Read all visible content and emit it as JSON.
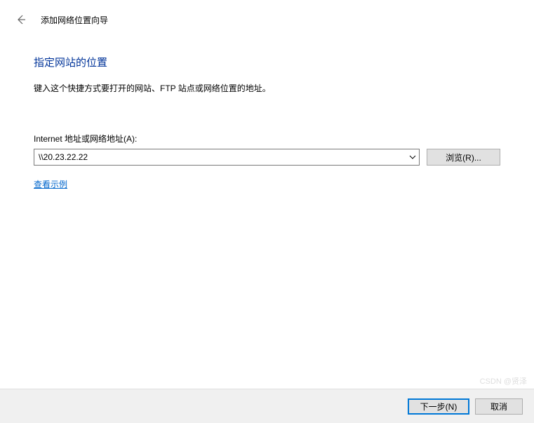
{
  "header": {
    "title": "添加网络位置向导"
  },
  "main": {
    "heading": "指定网站的位置",
    "description": "键入这个快捷方式要打开的网站、FTP 站点或网络位置的地址。",
    "field_label": "Internet 地址或网络地址(A):",
    "address_value": "\\\\20.23.22.22",
    "browse_label": "浏览(R)...",
    "example_link": "查看示例"
  },
  "footer": {
    "next_label": "下一步(N)",
    "cancel_label": "取消"
  },
  "watermark": "CSDN @贤泽"
}
